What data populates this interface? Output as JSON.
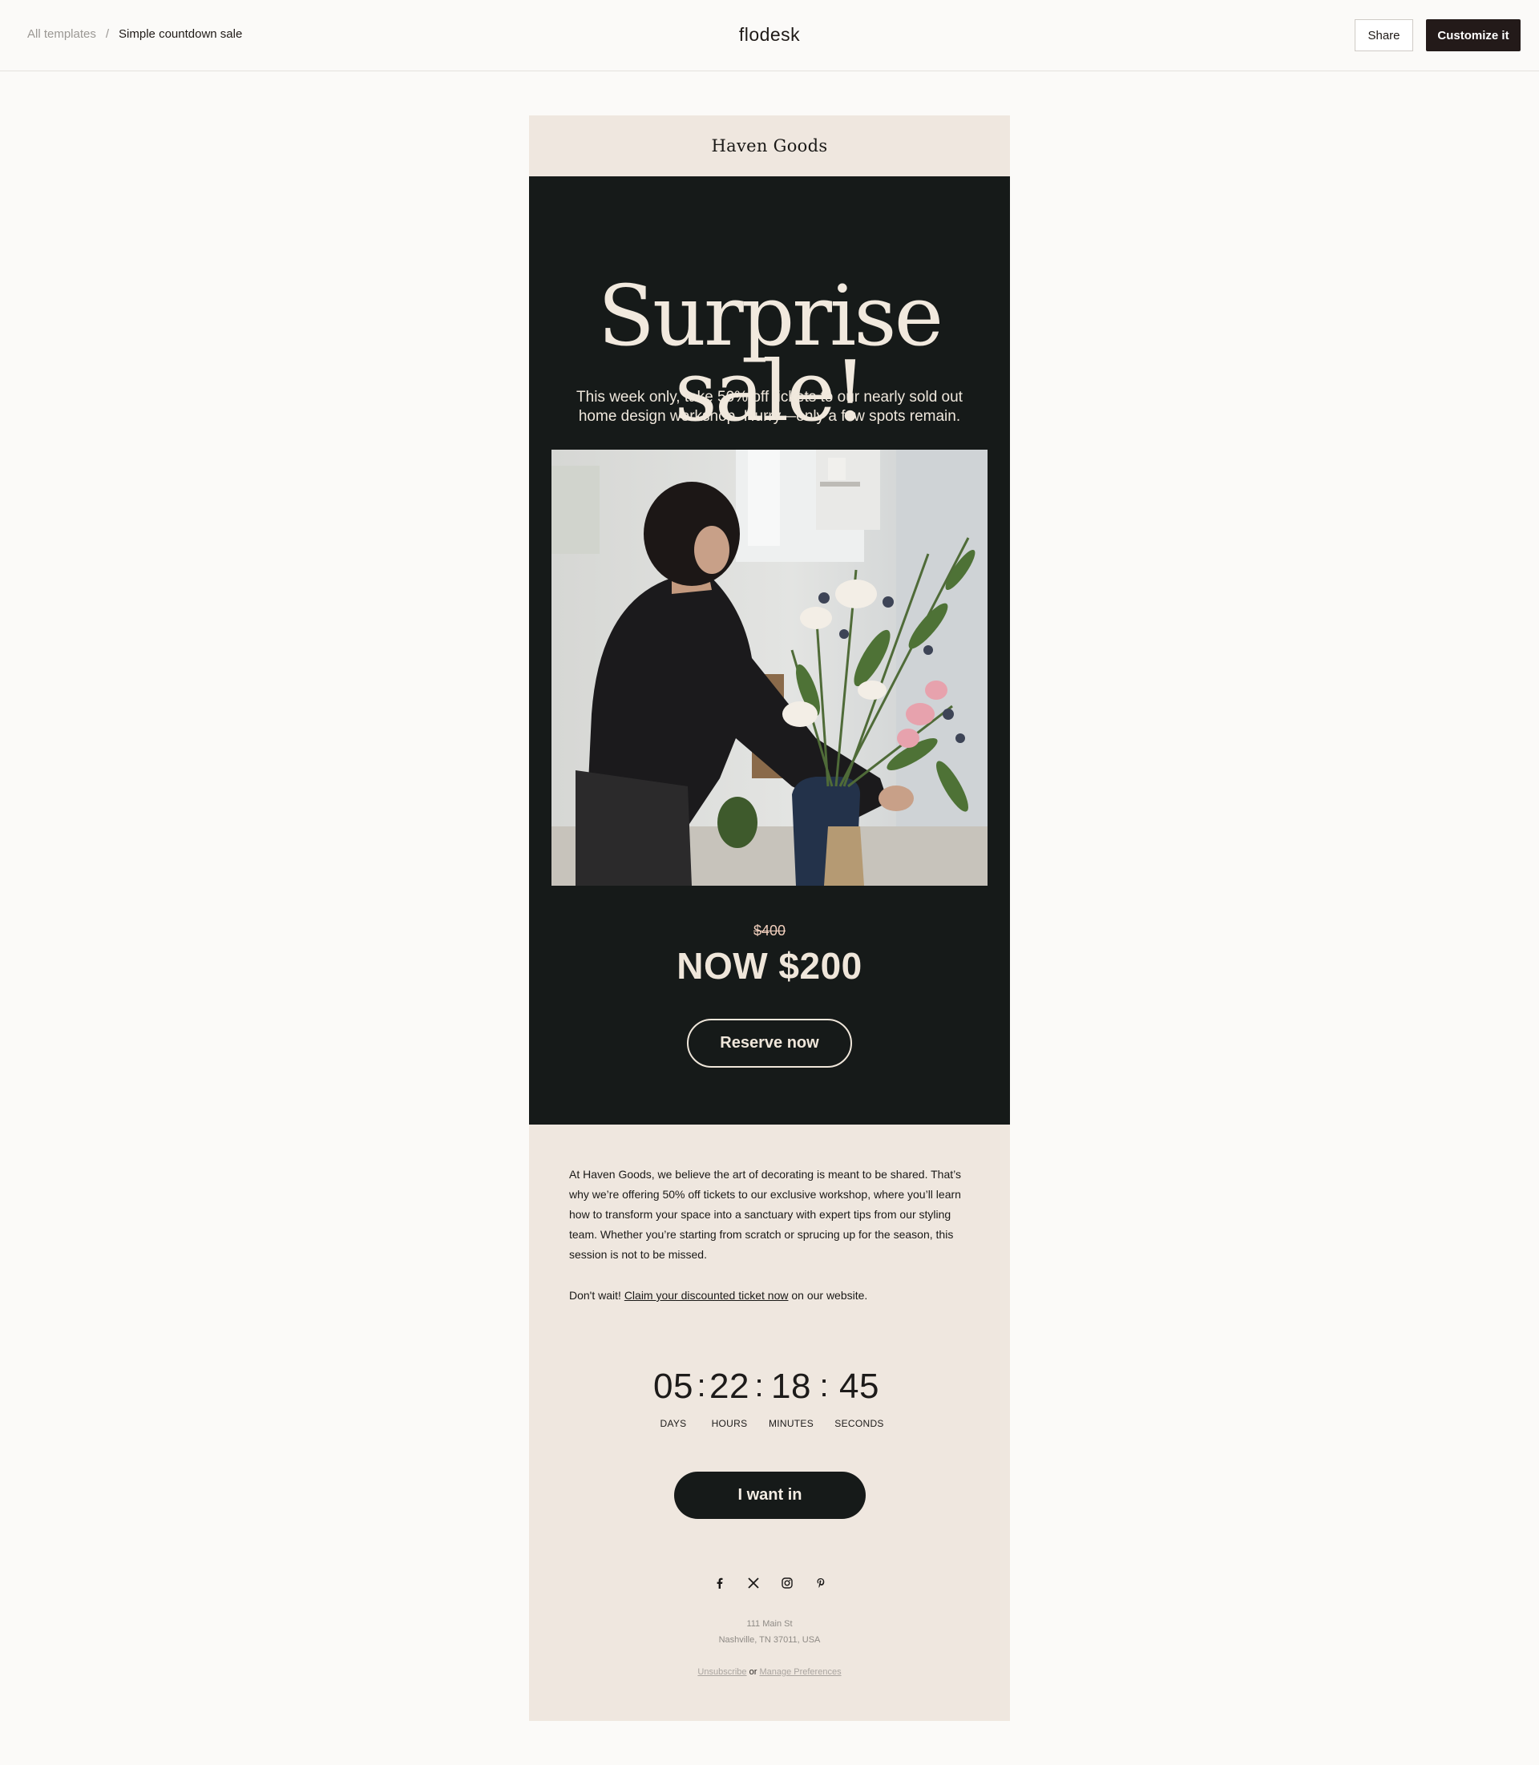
{
  "topbar": {
    "breadcrumb_root": "All templates",
    "breadcrumb_sep": "/",
    "breadcrumb_current": "Simple countdown sale",
    "logo": "flodesk",
    "share_label": "Share",
    "customize_label": "Customize it"
  },
  "email": {
    "brand": "Haven Goods",
    "hero": {
      "title_line1": "Surprise",
      "title_line2": "sale!",
      "subtitle": "This week only, take 50% off tickets to our nearly sold out home design workshop. Hurry—only a few spots remain.",
      "old_price": "$400",
      "now_price": "NOW $200",
      "reserve_label": "Reserve now"
    },
    "body": {
      "paragraph1": "At Haven Goods, we believe the art of decorating is meant to be shared. That’s why we’re offering 50% off tickets to our exclusive workshop, where you’ll  learn how to transform your space into a sanctuary with expert tips from our styling team. Whether you’re starting from scratch or sprucing up for the season, this session is not to be missed.",
      "p2_before": "Don't wait! ",
      "p2_link": "Claim your discounted ticket now",
      "p2_after": " on our website."
    },
    "countdown": {
      "days": "05",
      "hours": "22",
      "minutes": "18",
      "seconds": "45",
      "sep": ":",
      "days_label": "DAYS",
      "hours_label": "HOURS",
      "minutes_label": "MINUTES",
      "seconds_label": "SECONDS"
    },
    "cta_label": "I want in",
    "social_icons": [
      "facebook-icon",
      "x-icon",
      "instagram-icon",
      "pinterest-icon"
    ],
    "address_line1": "111 Main St",
    "address_line2": "Nashville, TN 37011, USA",
    "footer": {
      "unsubscribe": "Unsubscribe",
      "or": " or ",
      "manage": "Manage Preferences"
    }
  },
  "colors": {
    "dark": "#161a19",
    "cream": "#efe7df",
    "accent_button": "#231a19"
  }
}
